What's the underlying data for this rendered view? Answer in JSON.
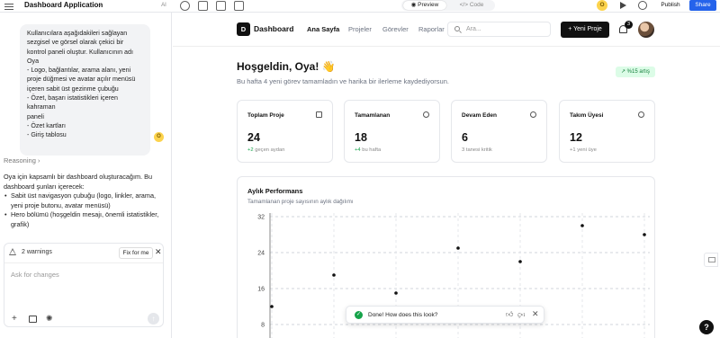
{
  "topbar": {
    "app_title": "Dashboard Application",
    "ai_label": "AI",
    "tabs": {
      "preview": "Preview",
      "code": "Code"
    },
    "user_initial": "O",
    "publish": "Publish",
    "share": "Share"
  },
  "chat": {
    "user_message": "Kullanıcılara aşağıdakileri sağlayan\nsezgisel ve görsel olarak çekici bir\nkontrol paneli oluştur. Kullanıcının adı\nOya\n- Logo, bağlantılar, arama alanı, yeni\nproje düğmesi ve avatar açılır menüsü\niçeren sabit üst gezinme çubuğu\n- Özet, başarı istatistikleri içeren kahraman\npaneli\n- Özet kartları\n- Giriş tablosu",
    "user_initial": "O",
    "reasoning_label": "Reasoning",
    "reply_intro": "Oya için kapsamlı bir dashboard oluşturacağım. Bu dashboard şunları içerecek:",
    "reply_items": [
      "Sabit üst navigasyon çubuğu (logo, linkler, arama, yeni proje butonu, avatar menüsü)",
      "Hero bölümü (hoşgeldin mesajı, önemli istatistikler, grafik)"
    ],
    "warnings_label": "2 warnings",
    "fix_label": "Fix for me",
    "input_placeholder": "Ask for changes"
  },
  "app": {
    "logo_letter": "D",
    "logo_text": "Dashboard",
    "nav_links": [
      "Ana Sayfa",
      "Projeler",
      "Görevler",
      "Raporlar"
    ],
    "search_placeholder": "Ara...",
    "new_project": "Yeni Proje",
    "notification_count": "3",
    "greeting": "Hoşgeldin, Oya! 👋",
    "subtitle": "Bu hafta 4 yeni görev tamamladın ve harika bir ilerleme kaydediyorsun.",
    "trend_badge": "↗ %15 artış",
    "stats": [
      {
        "label": "Toplam Proje",
        "value": "24",
        "note_hl": "+2",
        "note": " geçen aydan",
        "icon": "folder-icon"
      },
      {
        "label": "Tamamlanan",
        "value": "18",
        "note_hl": "+4",
        "note": " bu hafta",
        "icon": "check-circle-icon"
      },
      {
        "label": "Devam Eden",
        "value": "6",
        "note_hl": "",
        "note": "3 tanesi kritik",
        "icon": "clock-icon"
      },
      {
        "label": "Takım Üyesi",
        "value": "12",
        "note_hl": "",
        "note": "+1 yeni üye",
        "icon": "users-icon"
      }
    ],
    "chart_title": "Aylık Performans",
    "chart_subtitle": "Tamamlanan proje sayısının aylık dağılımı"
  },
  "chart_data": {
    "type": "scatter",
    "title": "Aylık Performans",
    "subtitle": "Tamamlanan proje sayısının aylık dağılımı",
    "xlabel": "",
    "ylabel": "",
    "y_ticks": [
      8,
      16,
      24,
      32
    ],
    "ylim": [
      0,
      32
    ],
    "grid": true,
    "points": [
      {
        "x": 1,
        "y": 12
      },
      {
        "x": 2,
        "y": 19
      },
      {
        "x": 3,
        "y": 15
      },
      {
        "x": 4,
        "y": 25
      },
      {
        "x": 5,
        "y": 22
      },
      {
        "x": 6,
        "y": 30
      },
      {
        "x": 7,
        "y": 28
      }
    ],
    "point_color": "#111111"
  },
  "toast": {
    "message": "Done! How does this look?"
  },
  "help_label": "?"
}
